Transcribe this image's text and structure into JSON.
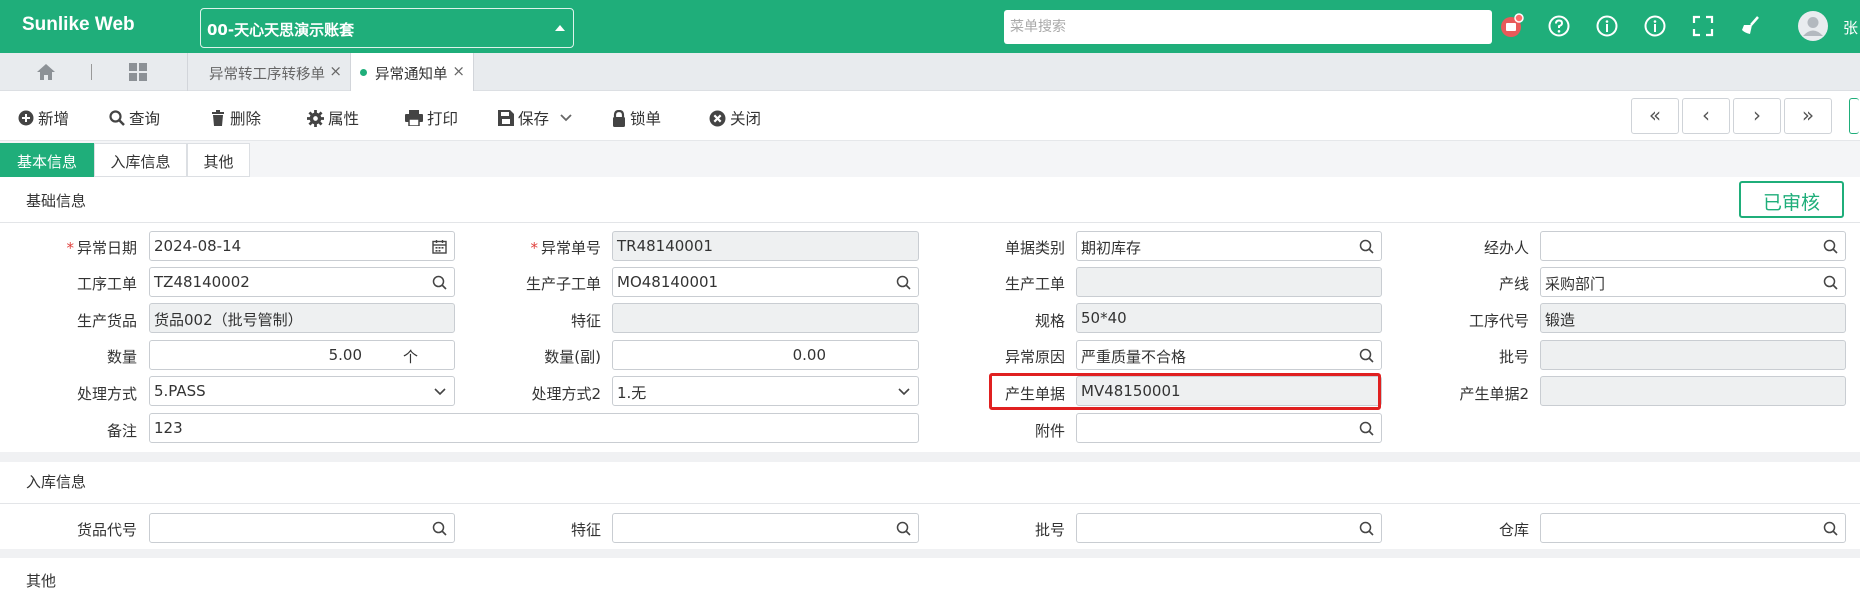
{
  "header": {
    "logo": "Sunlike Web",
    "account": "00-天心天思演示账套",
    "search_placeholder": "菜单搜索",
    "user_name": "张"
  },
  "tabs": {
    "open": [
      {
        "label": "异常转工序转移单",
        "active": false
      },
      {
        "label": "异常通知单",
        "active": true
      }
    ]
  },
  "toolbar": {
    "add": "新增",
    "query": "查询",
    "delete": "删除",
    "properties": "属性",
    "print": "打印",
    "save": "保存",
    "lock": "锁单",
    "close": "关闭"
  },
  "subtabs": [
    "基本信息",
    "入库信息",
    "其他"
  ],
  "sections": {
    "basic": "基础信息",
    "stock_in": "入库信息",
    "other": "其他"
  },
  "status_badge": "已审核",
  "form": {
    "exception_date": {
      "label": "异常日期",
      "value": "2024-08-14"
    },
    "exception_no": {
      "label": "异常单号",
      "value": "TR48140001"
    },
    "doc_category": {
      "label": "单据类别",
      "value": "期初库存"
    },
    "handler": {
      "label": "经办人",
      "value": ""
    },
    "process_order": {
      "label": "工序工单",
      "value": "TZ48140002"
    },
    "sub_order": {
      "label": "生产子工单",
      "value": "MO48140001"
    },
    "prod_order": {
      "label": "生产工单",
      "value": ""
    },
    "prod_line": {
      "label": "产线",
      "value": "采购部门"
    },
    "prod_goods": {
      "label": "生产货品",
      "value": "货品002（批号管制）"
    },
    "feature": {
      "label": "特征",
      "value": ""
    },
    "spec": {
      "label": "规格",
      "value": "50*40"
    },
    "process_code": {
      "label": "工序代号",
      "value": "锻造"
    },
    "quantity": {
      "label": "数量",
      "value": "5.00",
      "unit": "个"
    },
    "quantity_sub": {
      "label": "数量(副)",
      "value": "0.00"
    },
    "exception_reason": {
      "label": "异常原因",
      "value": "严重质量不合格"
    },
    "batch_no": {
      "label": "批号",
      "value": ""
    },
    "handling": {
      "label": "处理方式",
      "value": "5.PASS"
    },
    "handling2": {
      "label": "处理方式2",
      "value": "1.无"
    },
    "source_doc": {
      "label": "产生单据",
      "value": "MV48150001"
    },
    "source_doc2": {
      "label": "产生单据2",
      "value": ""
    },
    "remark": {
      "label": "备注",
      "value": "123"
    },
    "attachment": {
      "label": "附件",
      "value": ""
    }
  },
  "stock_form": {
    "goods_code": {
      "label": "货品代号",
      "value": ""
    },
    "feature": {
      "label": "特征",
      "value": ""
    },
    "batch_no": {
      "label": "批号",
      "value": ""
    },
    "warehouse": {
      "label": "仓库",
      "value": ""
    }
  },
  "colors": {
    "brand": "#1fae7a",
    "highlight": "#e02020",
    "required": "#e0413d"
  }
}
